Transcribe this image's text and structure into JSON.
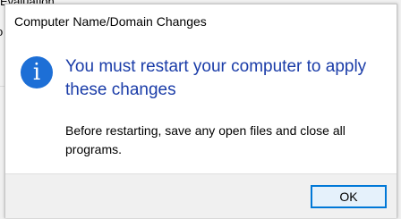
{
  "background": {
    "top_text": "Evaluation",
    "fragment_1": "o",
    "fragment_2": ")"
  },
  "dialog": {
    "title": "Computer Name/Domain Changes",
    "icon": "info-icon",
    "main_instruction": "You must restart your computer to apply these changes",
    "content": "Before restarting, save any open files and close all programs.",
    "ok_label": "OK"
  },
  "colors": {
    "accent": "#1d6fd6",
    "instruction_text": "#1a3ca8",
    "button_border": "#0078d7"
  }
}
